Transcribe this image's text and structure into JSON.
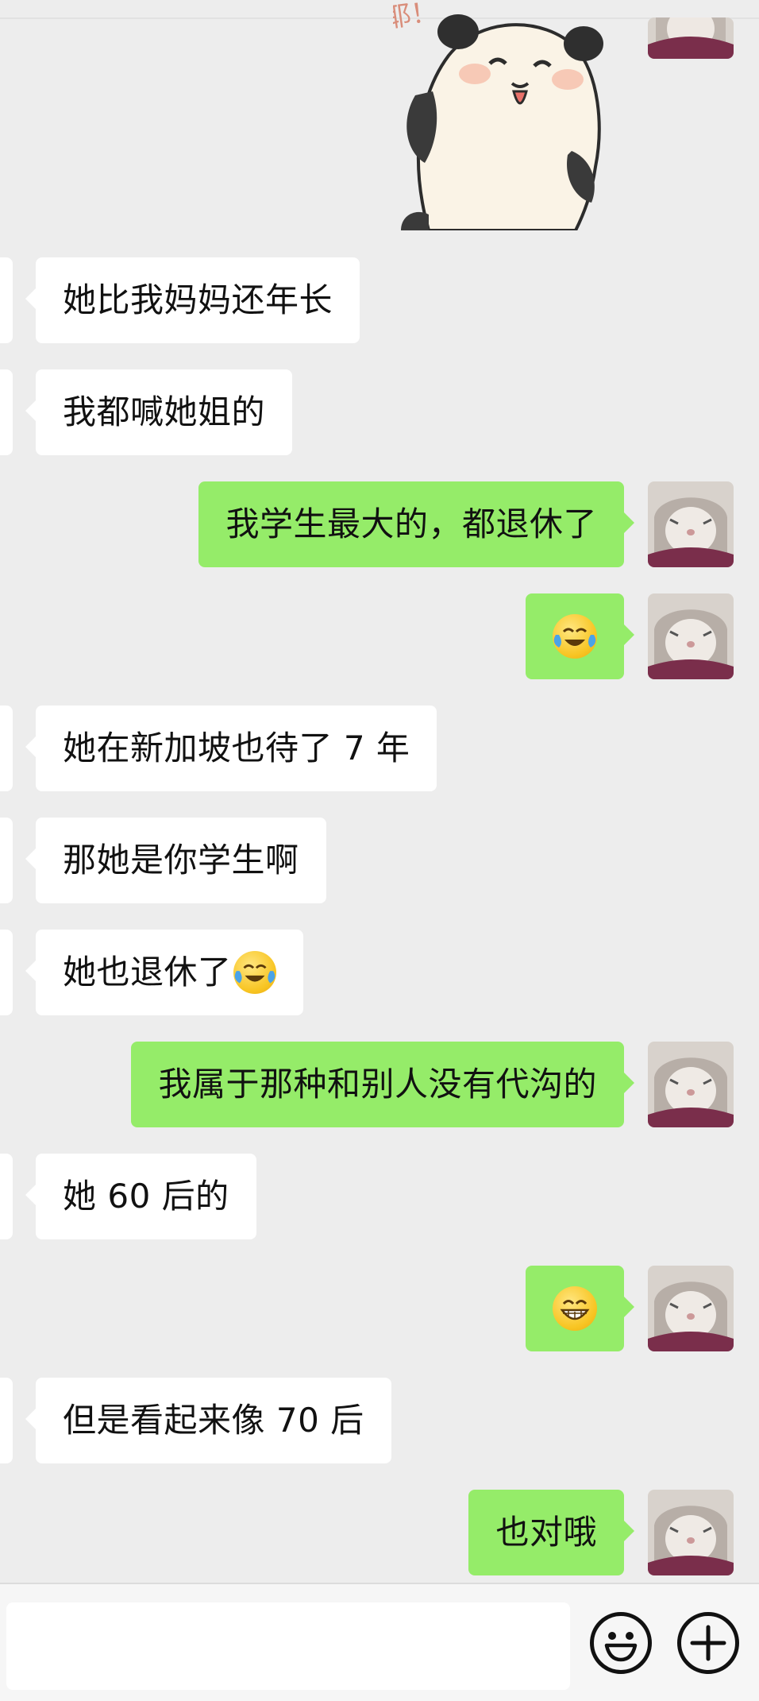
{
  "messages": [
    {
      "side": "in",
      "text": "她比我妈妈还年长"
    },
    {
      "side": "in",
      "text": "我都喊她姐的"
    },
    {
      "side": "out",
      "text": "我学生最大的，都退休了"
    },
    {
      "side": "out",
      "emoji": "😂"
    },
    {
      "side": "in",
      "text": "她在新加坡也待了 7 年"
    },
    {
      "side": "in",
      "text": "那她是你学生啊"
    },
    {
      "side": "in",
      "text": "她也退休了",
      "emoji": "😂"
    },
    {
      "side": "out",
      "text": "我属于那种和别人没有代沟的"
    },
    {
      "side": "in",
      "text": "她 60 后的"
    },
    {
      "side": "out",
      "emoji": "😁"
    },
    {
      "side": "in",
      "text": "但是看起来像 70 后"
    },
    {
      "side": "out",
      "text": "也对哦"
    }
  ],
  "sticker": {
    "visible_text": "耶！"
  },
  "input_bar": {
    "placeholder": ""
  },
  "icons": {
    "emoji_button": "smiley-face-icon",
    "more_button": "plus-circle-icon"
  },
  "colors": {
    "background": "#ededed",
    "incoming_bubble": "#ffffff",
    "outgoing_bubble": "#95ec69"
  }
}
